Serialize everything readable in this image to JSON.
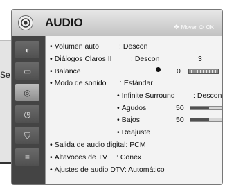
{
  "background": {
    "partial_text": "Se"
  },
  "menu": {
    "title": "AUDIO",
    "hint_move": "Mover",
    "hint_ok": "OK",
    "hint_move_icon": "dpad-icon",
    "hint_ok_icon": "ok-dot-icon",
    "colors": {
      "header": "#d4d4d4",
      "panel": "#f3f3f3",
      "sidebar": "#444444",
      "bar_fill": "#505050"
    }
  },
  "sidebar": {
    "items": [
      {
        "icon": "picture-icon",
        "glyph": "◐",
        "active": false
      },
      {
        "icon": "screen-icon",
        "glyph": "▭",
        "active": false
      },
      {
        "icon": "audio-icon",
        "glyph": "◎",
        "active": true
      },
      {
        "icon": "clock-icon",
        "glyph": "◷",
        "active": false
      },
      {
        "icon": "lock-icon",
        "glyph": "⛉",
        "active": false
      },
      {
        "icon": "options-icon",
        "glyph": "≡",
        "active": false
      }
    ]
  },
  "settings": {
    "volumen_auto": {
      "label": "Volumen auto",
      "value": ": Descon"
    },
    "dialogos_claros": {
      "label": "Diálogos Claros II",
      "value": ": Descon",
      "level": "3"
    },
    "balance": {
      "label": "Balance",
      "value": "0"
    },
    "modo_sonido": {
      "label": "Modo de sonido",
      "value": ": Estándar"
    },
    "infinite_surround": {
      "label": "Infinite Surround",
      "value": ": Descon"
    },
    "agudos": {
      "label": "Agudos",
      "value": "50",
      "level_fraction": 0.5
    },
    "bajos": {
      "label": "Bajos",
      "value": "50",
      "level_fraction": 0.5
    },
    "reajuste": {
      "label": "Reajuste"
    },
    "salida_audio": {
      "label": "Salida de audio digital: PCM"
    },
    "altavoces": {
      "label": "Altavoces de TV",
      "value": ": Conex"
    },
    "ajustes_dtv": {
      "label": "Ajustes de audio DTV: Automático"
    }
  }
}
